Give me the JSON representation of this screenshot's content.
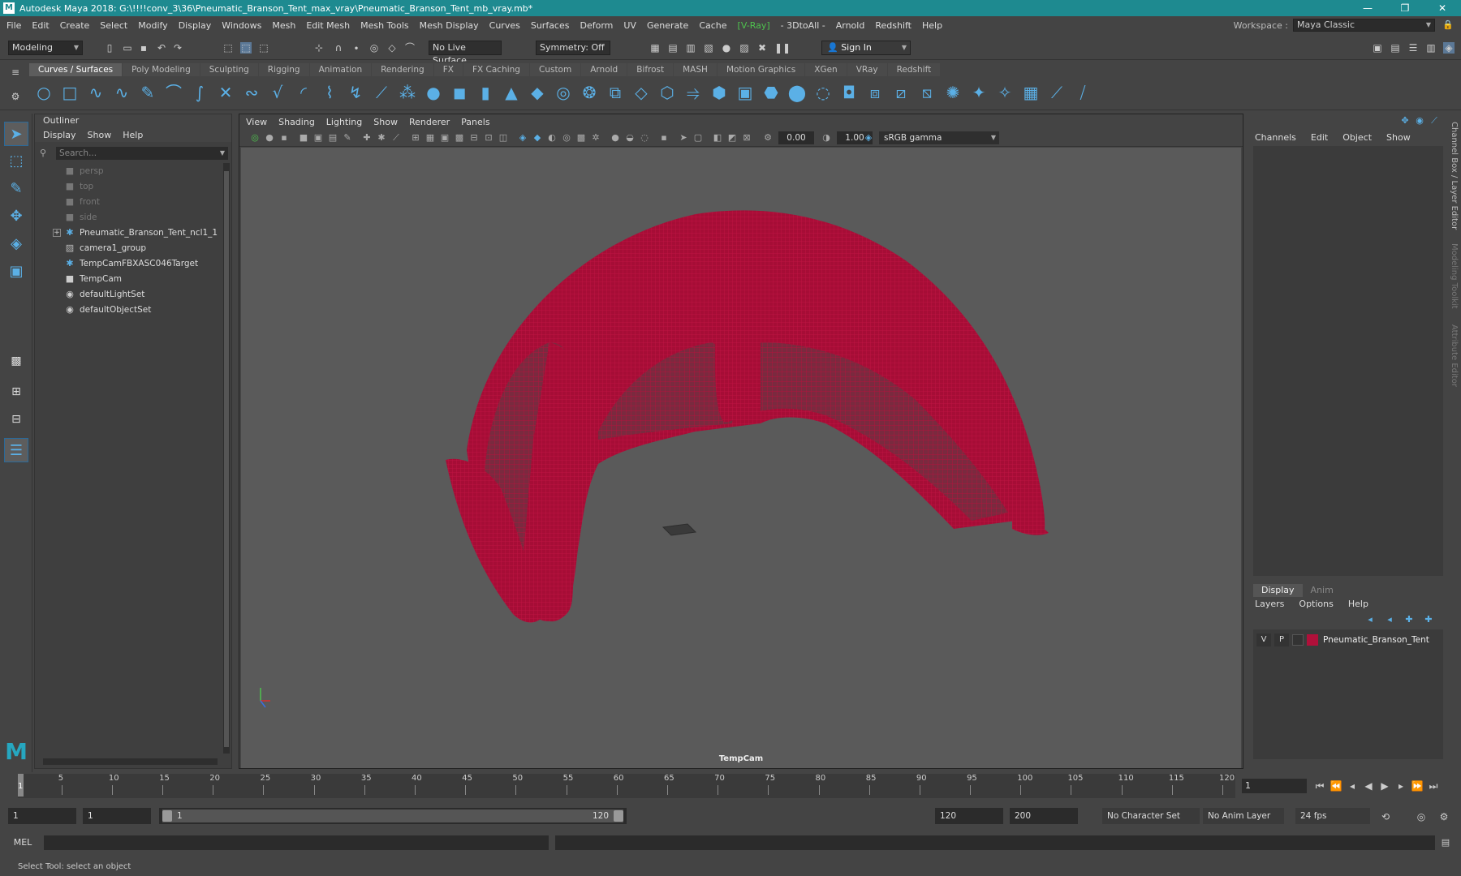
{
  "window": {
    "logo_letter": "M",
    "title": "Autodesk Maya 2018: G:\\!!!!conv_3\\36\\Pneumatic_Branson_Tent_max_vray\\Pneumatic_Branson_Tent_mb_vray.mb*",
    "minimize": "—",
    "maximize": "❐",
    "close": "✕"
  },
  "menubar": {
    "items": [
      "File",
      "Edit",
      "Create",
      "Select",
      "Modify",
      "Display",
      "Windows",
      "Mesh",
      "Edit Mesh",
      "Mesh Tools",
      "Mesh Display",
      "Curves",
      "Surfaces",
      "Deform",
      "UV",
      "Generate",
      "Cache",
      "[V-Ray]",
      "- 3DtoAll -",
      "Arnold",
      "Redshift",
      "Help"
    ],
    "workspace_label": "Workspace :",
    "workspace_value": "Maya Classic"
  },
  "statusline": {
    "mode": "Modeling",
    "live_surface": "No Live Surface",
    "symmetry": "Symmetry: Off",
    "sign_in": "Sign In"
  },
  "shelf": {
    "tabs": [
      "Curves / Surfaces",
      "Poly Modeling",
      "Sculpting",
      "Rigging",
      "Animation",
      "Rendering",
      "FX",
      "FX Caching",
      "Custom",
      "Arnold",
      "Bifrost",
      "MASH",
      "Motion Graphics",
      "XGen",
      "VRay",
      "Redshift"
    ],
    "active_tab": "Curves / Surfaces"
  },
  "outliner": {
    "title": "Outliner",
    "menu": [
      "Display",
      "Show",
      "Help"
    ],
    "search_placeholder": "Search...",
    "items": [
      {
        "label": "persp",
        "icon": "camera-icon",
        "dim": true
      },
      {
        "label": "top",
        "icon": "camera-icon",
        "dim": true
      },
      {
        "label": "front",
        "icon": "camera-icon",
        "dim": true
      },
      {
        "label": "side",
        "icon": "camera-icon",
        "dim": true
      },
      {
        "label": "Pneumatic_Branson_Tent_ncl1_1",
        "icon": "transform-icon",
        "dim": false,
        "expandable": true
      },
      {
        "label": "camera1_group",
        "icon": "group-icon",
        "dim": false
      },
      {
        "label": "TempCamFBXASC046Target",
        "icon": "transform-icon",
        "dim": false
      },
      {
        "label": "TempCam",
        "icon": "camera-icon",
        "dim": false
      },
      {
        "label": "defaultLightSet",
        "icon": "set-icon",
        "dim": false
      },
      {
        "label": "defaultObjectSet",
        "icon": "set-icon",
        "dim": false
      }
    ]
  },
  "viewport": {
    "menu": [
      "View",
      "Shading",
      "Lighting",
      "Show",
      "Renderer",
      "Panels"
    ],
    "exposure": "0.00",
    "gamma": "1.00",
    "color_space": "sRGB gamma",
    "camera_label": "TempCam",
    "mesh_color": "#b0103a"
  },
  "channelbox": {
    "menu": [
      "Channels",
      "Edit",
      "Object",
      "Show"
    ]
  },
  "layers": {
    "tabs": [
      "Display",
      "Anim"
    ],
    "menu": [
      "Layers",
      "Options",
      "Help"
    ],
    "rows": [
      {
        "v": "V",
        "p": "P",
        "name": "Pneumatic_Branson_Tent",
        "color": "#b0103a"
      }
    ]
  },
  "side_tabs": [
    "Channel Box / Layer Editor",
    "Modeling Toolkit",
    "Attribute Editor"
  ],
  "timeline": {
    "ticks": [
      5,
      10,
      15,
      20,
      25,
      30,
      35,
      40,
      45,
      50,
      55,
      60,
      65,
      70,
      75,
      80,
      85,
      90,
      95,
      100,
      105,
      110,
      115,
      120
    ],
    "current_frame_mark": "1",
    "current_frame_field": "1"
  },
  "range": {
    "start": "1",
    "playback_start": "1",
    "range_start": "1",
    "range_end": "120",
    "playback_end": "120",
    "end": "200",
    "character_set": "No Character Set",
    "anim_layer": "No Anim Layer",
    "fps": "24 fps"
  },
  "command": {
    "label": "MEL"
  },
  "help": {
    "text": "Select Tool: select an object"
  }
}
